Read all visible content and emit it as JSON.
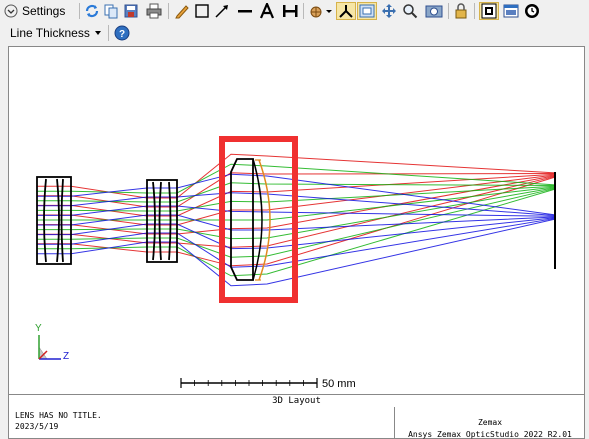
{
  "toolbar": {
    "settings_label": "Settings"
  },
  "toolbar2": {
    "line_thickness_label": "Line Thickness"
  },
  "layout": {
    "scale_label": "50 mm",
    "title": "3D Layout",
    "axis_y": "Y",
    "axis_z": "Z"
  },
  "footer": {
    "lens_title": "LENS HAS NO TITLE.",
    "date": "2023/5/19",
    "brand": "Zemax",
    "product": "Ansys Zemax OpticStudio 2022 R2.01"
  },
  "colors": {
    "ray_blue": "#1010e0",
    "ray_green": "#10b010",
    "ray_red": "#e01010",
    "highlight": "#f03030",
    "lens_orange": "#e08a20"
  },
  "icons": [
    "settings-expand-icon",
    "refresh-icon",
    "copy-icon",
    "save-icon",
    "print-icon",
    "pencil-icon",
    "rectangle-icon",
    "arrow-icon",
    "line-icon",
    "text-icon",
    "dimension-icon",
    "rotate-icon",
    "axes-icon",
    "fit-icon",
    "pan-icon",
    "zoom-icon",
    "snapshot-icon",
    "lock-icon",
    "grid-icon",
    "window-icon",
    "clock-icon",
    "help-icon"
  ]
}
